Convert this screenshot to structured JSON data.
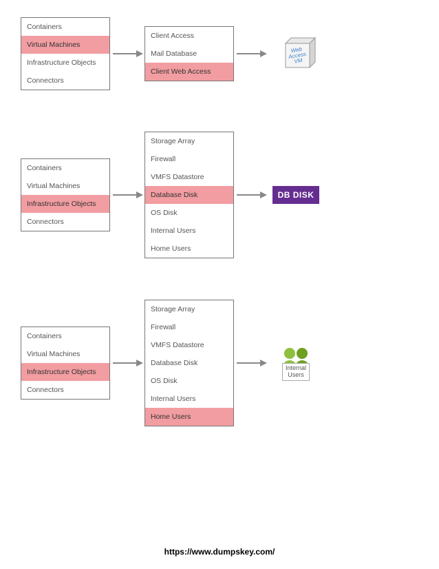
{
  "rows": [
    {
      "left": {
        "items": [
          "Containers",
          "Virtual Machines",
          "Infrastructure Objects",
          "Connectors"
        ],
        "selected": 1
      },
      "middle": {
        "items": [
          "Client Access",
          "Mail Database",
          "Client Web Access"
        ],
        "selected": 2
      },
      "result": {
        "type": "cube",
        "label_lines": [
          "Web",
          "Access",
          "VM"
        ]
      }
    },
    {
      "left": {
        "items": [
          "Containers",
          "Virtual Machines",
          "Infrastructure Objects",
          "Connectors"
        ],
        "selected": 2
      },
      "middle": {
        "items": [
          "Storage Array",
          "Firewall",
          "VMFS Datastore",
          "Database Disk",
          "OS Disk",
          "Internal Users",
          "Home Users"
        ],
        "selected": 3
      },
      "result": {
        "type": "dbdisk",
        "label": "DB DISK"
      }
    },
    {
      "left": {
        "items": [
          "Containers",
          "Virtual Machines",
          "Infrastructure Objects",
          "Connectors"
        ],
        "selected": 2
      },
      "middle": {
        "items": [
          "Storage Array",
          "Firewall",
          "VMFS Datastore",
          "Database Disk",
          "OS Disk",
          "Internal Users",
          "Home Users"
        ],
        "selected": 6
      },
      "result": {
        "type": "users",
        "label_lines": [
          "Internal",
          "Users"
        ]
      }
    }
  ],
  "footer_url": "https://www.dumpskey.com/"
}
